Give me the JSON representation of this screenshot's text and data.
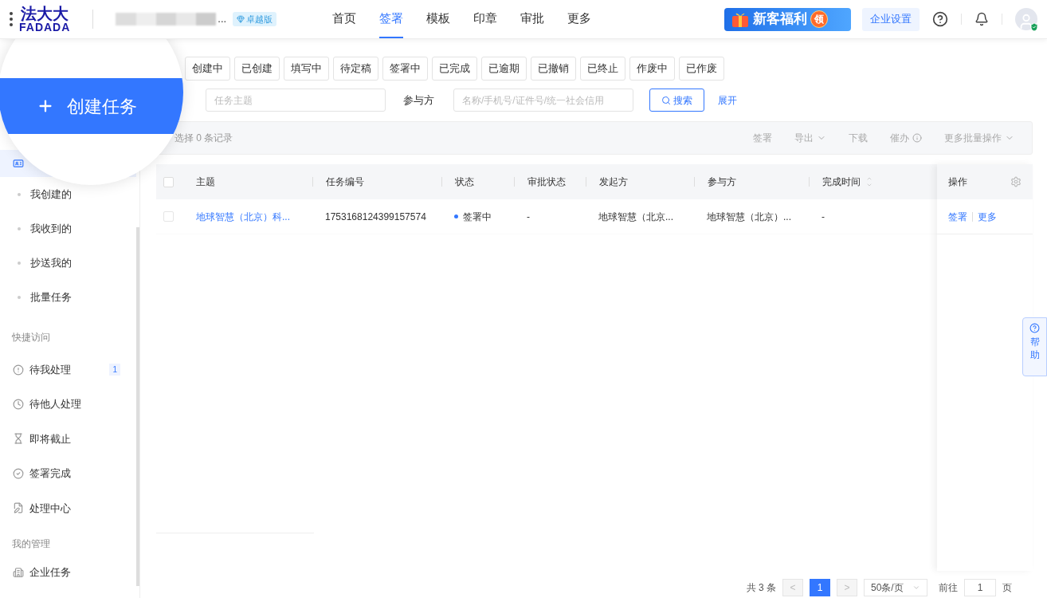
{
  "header": {
    "logo_cn": "法大大",
    "logo_en": "FADADA",
    "company_suffix": "...",
    "edition": "卓越版",
    "nav": [
      {
        "label": "首页",
        "selected": false
      },
      {
        "label": "签署",
        "selected": true
      },
      {
        "label": "模板",
        "selected": false
      },
      {
        "label": "印章",
        "selected": false
      },
      {
        "label": "审批",
        "selected": false
      },
      {
        "label": "更多",
        "selected": false
      }
    ],
    "promo": {
      "label": "新客福利",
      "badge": "领"
    },
    "settings": "企业设置"
  },
  "spotlight": {
    "button": "创建任务"
  },
  "sidebar": {
    "tasks": [
      {
        "label": "我创建的",
        "selected": false
      },
      {
        "label": "我收到的",
        "selected": false
      },
      {
        "label": "抄送我的",
        "selected": false
      },
      {
        "label": "批量任务",
        "selected": false
      }
    ],
    "quick_title": "快捷访问",
    "quick": [
      {
        "kind": "alert",
        "label": "待我处理",
        "count": "1"
      },
      {
        "kind": "clock",
        "label": "待他人处理"
      },
      {
        "kind": "hourglass",
        "label": "即将截止"
      },
      {
        "kind": "check",
        "label": "签署完成"
      },
      {
        "kind": "edit",
        "label": "处理中心"
      }
    ],
    "manage_title": "我的管理",
    "manage": [
      {
        "kind": "building",
        "label": "企业任务"
      }
    ]
  },
  "filters": [
    {
      "label": "创建中",
      "selected": false
    },
    {
      "label": "已创建",
      "selected": false
    },
    {
      "label": "填写中",
      "selected": false
    },
    {
      "label": "待定稿",
      "selected": false
    },
    {
      "label": "签署中",
      "selected": false
    },
    {
      "label": "已完成",
      "selected": false
    },
    {
      "label": "已逾期",
      "selected": false
    },
    {
      "label": "已撤销",
      "selected": false
    },
    {
      "label": "已终止",
      "selected": false
    },
    {
      "label": "作废中",
      "selected": false
    },
    {
      "label": "已作废",
      "selected": false
    }
  ],
  "search": {
    "subject_placeholder": "任务主题",
    "party_label": "参与方",
    "party_placeholder": "名称/手机号/证件号/统一社会信用",
    "button": "搜索",
    "expand": "展开"
  },
  "toolbar": {
    "selected_text": "选择 0 条记录",
    "actions": [
      {
        "label": "签署",
        "kind": "plain"
      },
      {
        "label": "导出",
        "kind": "dropdown"
      },
      {
        "label": "下载",
        "kind": "plain"
      },
      {
        "label": "催办",
        "kind": "info"
      },
      {
        "label": "更多批量操作",
        "kind": "dropdown"
      }
    ]
  },
  "table": {
    "select_all_checked": false,
    "columns": [
      "主题",
      "任务编号",
      "状态",
      "审批状态",
      "发起方",
      "参与方",
      "完成时间"
    ],
    "action_column": "操作",
    "rows": [
      {
        "checked": false,
        "subject": "地球智慧（北京）科...",
        "number": "1753168124399157574",
        "status": "签署中",
        "approval": "-",
        "initiator": "地球智慧（北京...",
        "party": "地球智慧（北京）...",
        "finished": "-",
        "actions": [
          "签署",
          "更多"
        ]
      }
    ]
  },
  "help": "帮助",
  "pagination": {
    "total": "共 3 条",
    "prev": "<",
    "pages": [
      {
        "label": "1",
        "selected": true
      }
    ],
    "next": ">",
    "page_size": "50条/页",
    "goto": "前往",
    "goto_value": "1",
    "page_unit": "页"
  }
}
